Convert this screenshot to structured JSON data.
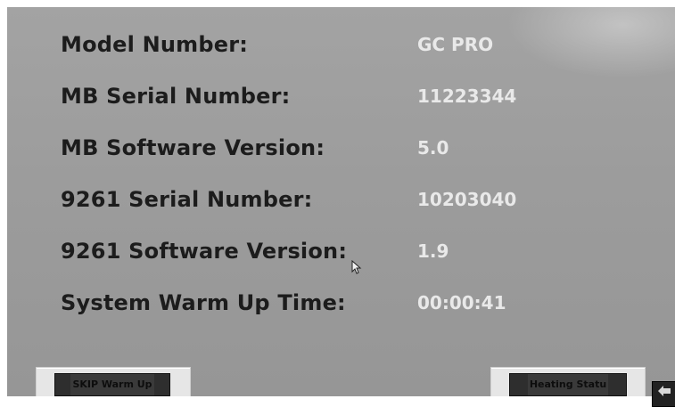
{
  "info_rows": [
    {
      "label": "Model Number:",
      "value": "GC PRO"
    },
    {
      "label": "MB Serial Number:",
      "value": "11223344"
    },
    {
      "label": "MB Software Version:",
      "value": "5.0"
    },
    {
      "label": "9261 Serial Number:",
      "value": "10203040"
    },
    {
      "label": "9261 Software Version:",
      "value": "1.9"
    },
    {
      "label": "System Warm Up Time:",
      "value": "00:00:41"
    }
  ],
  "buttons": {
    "skip_warm_up": "SKIP Warm Up",
    "heating_status": "Heating Statu"
  },
  "icons": {
    "back": "back-arrow-icon",
    "cursor": "mouse-cursor-icon"
  }
}
